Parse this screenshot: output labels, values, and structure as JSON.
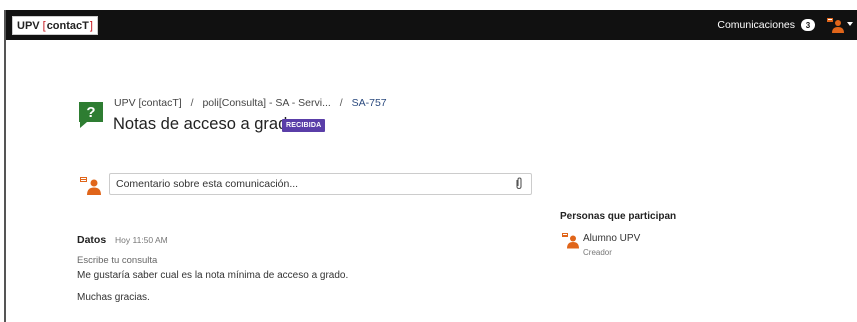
{
  "topbar": {
    "logo_left": "UPV",
    "logo_bracket_open": "[",
    "logo_name": "contacT",
    "logo_bracket_close": "]",
    "communications_label": "Comunicaciones",
    "communications_count": "3"
  },
  "header": {
    "breadcrumb": [
      {
        "label": "UPV [contacT]"
      },
      {
        "label": "poli[Consulta] - SA - Servi..."
      },
      {
        "label": "SA-757"
      }
    ],
    "separator": "/",
    "title": "Notas de acceso a grado",
    "status": "RECIBIDA"
  },
  "comment": {
    "placeholder": "Comentario sobre esta comunicación..."
  },
  "message": {
    "author": "Datos",
    "time": "Hoy 11:50 AM",
    "subject": "Escribe tu consulta",
    "body": [
      "Me gustaría saber cual es la nota mínima de acceso a grado.",
      "Muchas gracias."
    ]
  },
  "participants": {
    "title": "Personas que participan",
    "items": [
      {
        "name": "Alumno UPV",
        "role": "Creador"
      }
    ]
  },
  "colors": {
    "topbar": "#111111",
    "badge": "#5a3ea8",
    "question_icon": "#2e7d32",
    "user_icon": "#e0651a"
  },
  "icons": [
    "question-icon",
    "user-icon",
    "paperclip-icon",
    "caret-down-icon"
  ]
}
